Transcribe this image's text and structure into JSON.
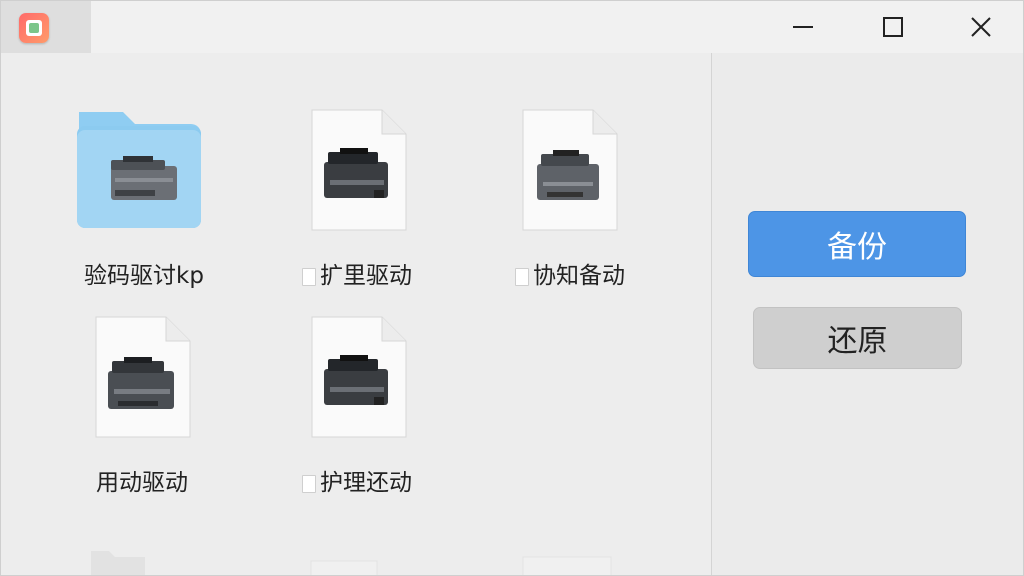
{
  "window": {
    "controls": {
      "minimize_icon": "minimize-icon",
      "maximize_icon": "maximize-icon",
      "close_icon": "close-icon"
    }
  },
  "files": [
    {
      "label": "验码驱讨kp",
      "type": "folder"
    },
    {
      "label": "扩里驱动",
      "type": "document"
    },
    {
      "label": "协知备动",
      "type": "document"
    },
    {
      "label": "用动驱动",
      "type": "document"
    },
    {
      "label": "护理还动",
      "type": "document"
    }
  ],
  "actions": {
    "backup_label": "备份",
    "restore_label": "还原"
  },
  "colors": {
    "accent": "#4d95e6",
    "folder": "#7fc2ee",
    "restore_button": "#cfcfcf"
  }
}
